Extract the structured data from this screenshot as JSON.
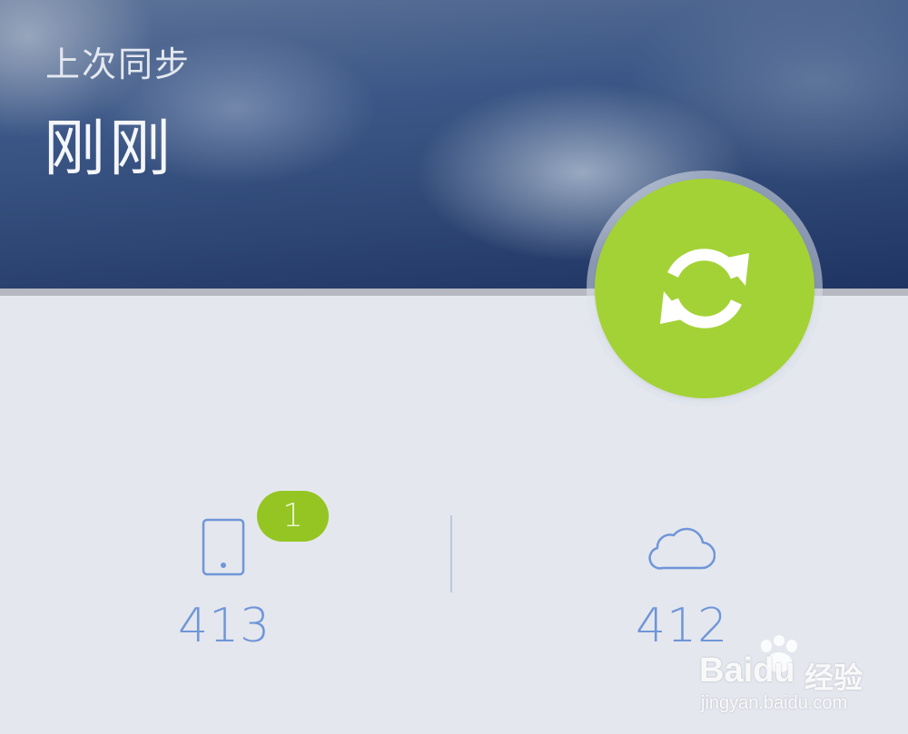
{
  "header": {
    "last_sync_label": "上次同步",
    "last_sync_value": "刚刚"
  },
  "sync_button": {
    "icon": "sync-icon",
    "color": "#a3d236"
  },
  "local": {
    "icon": "phone-icon",
    "count": "413",
    "badge": "1",
    "badge_color": "#94c523"
  },
  "cloud": {
    "icon": "cloud-icon",
    "count": "412"
  },
  "watermark": {
    "brand": "Baidu",
    "product": "经验",
    "url": "jingyan.baidu.com"
  },
  "colors": {
    "accent_blue": "#6f96d8",
    "background": "#e5e7ee"
  }
}
